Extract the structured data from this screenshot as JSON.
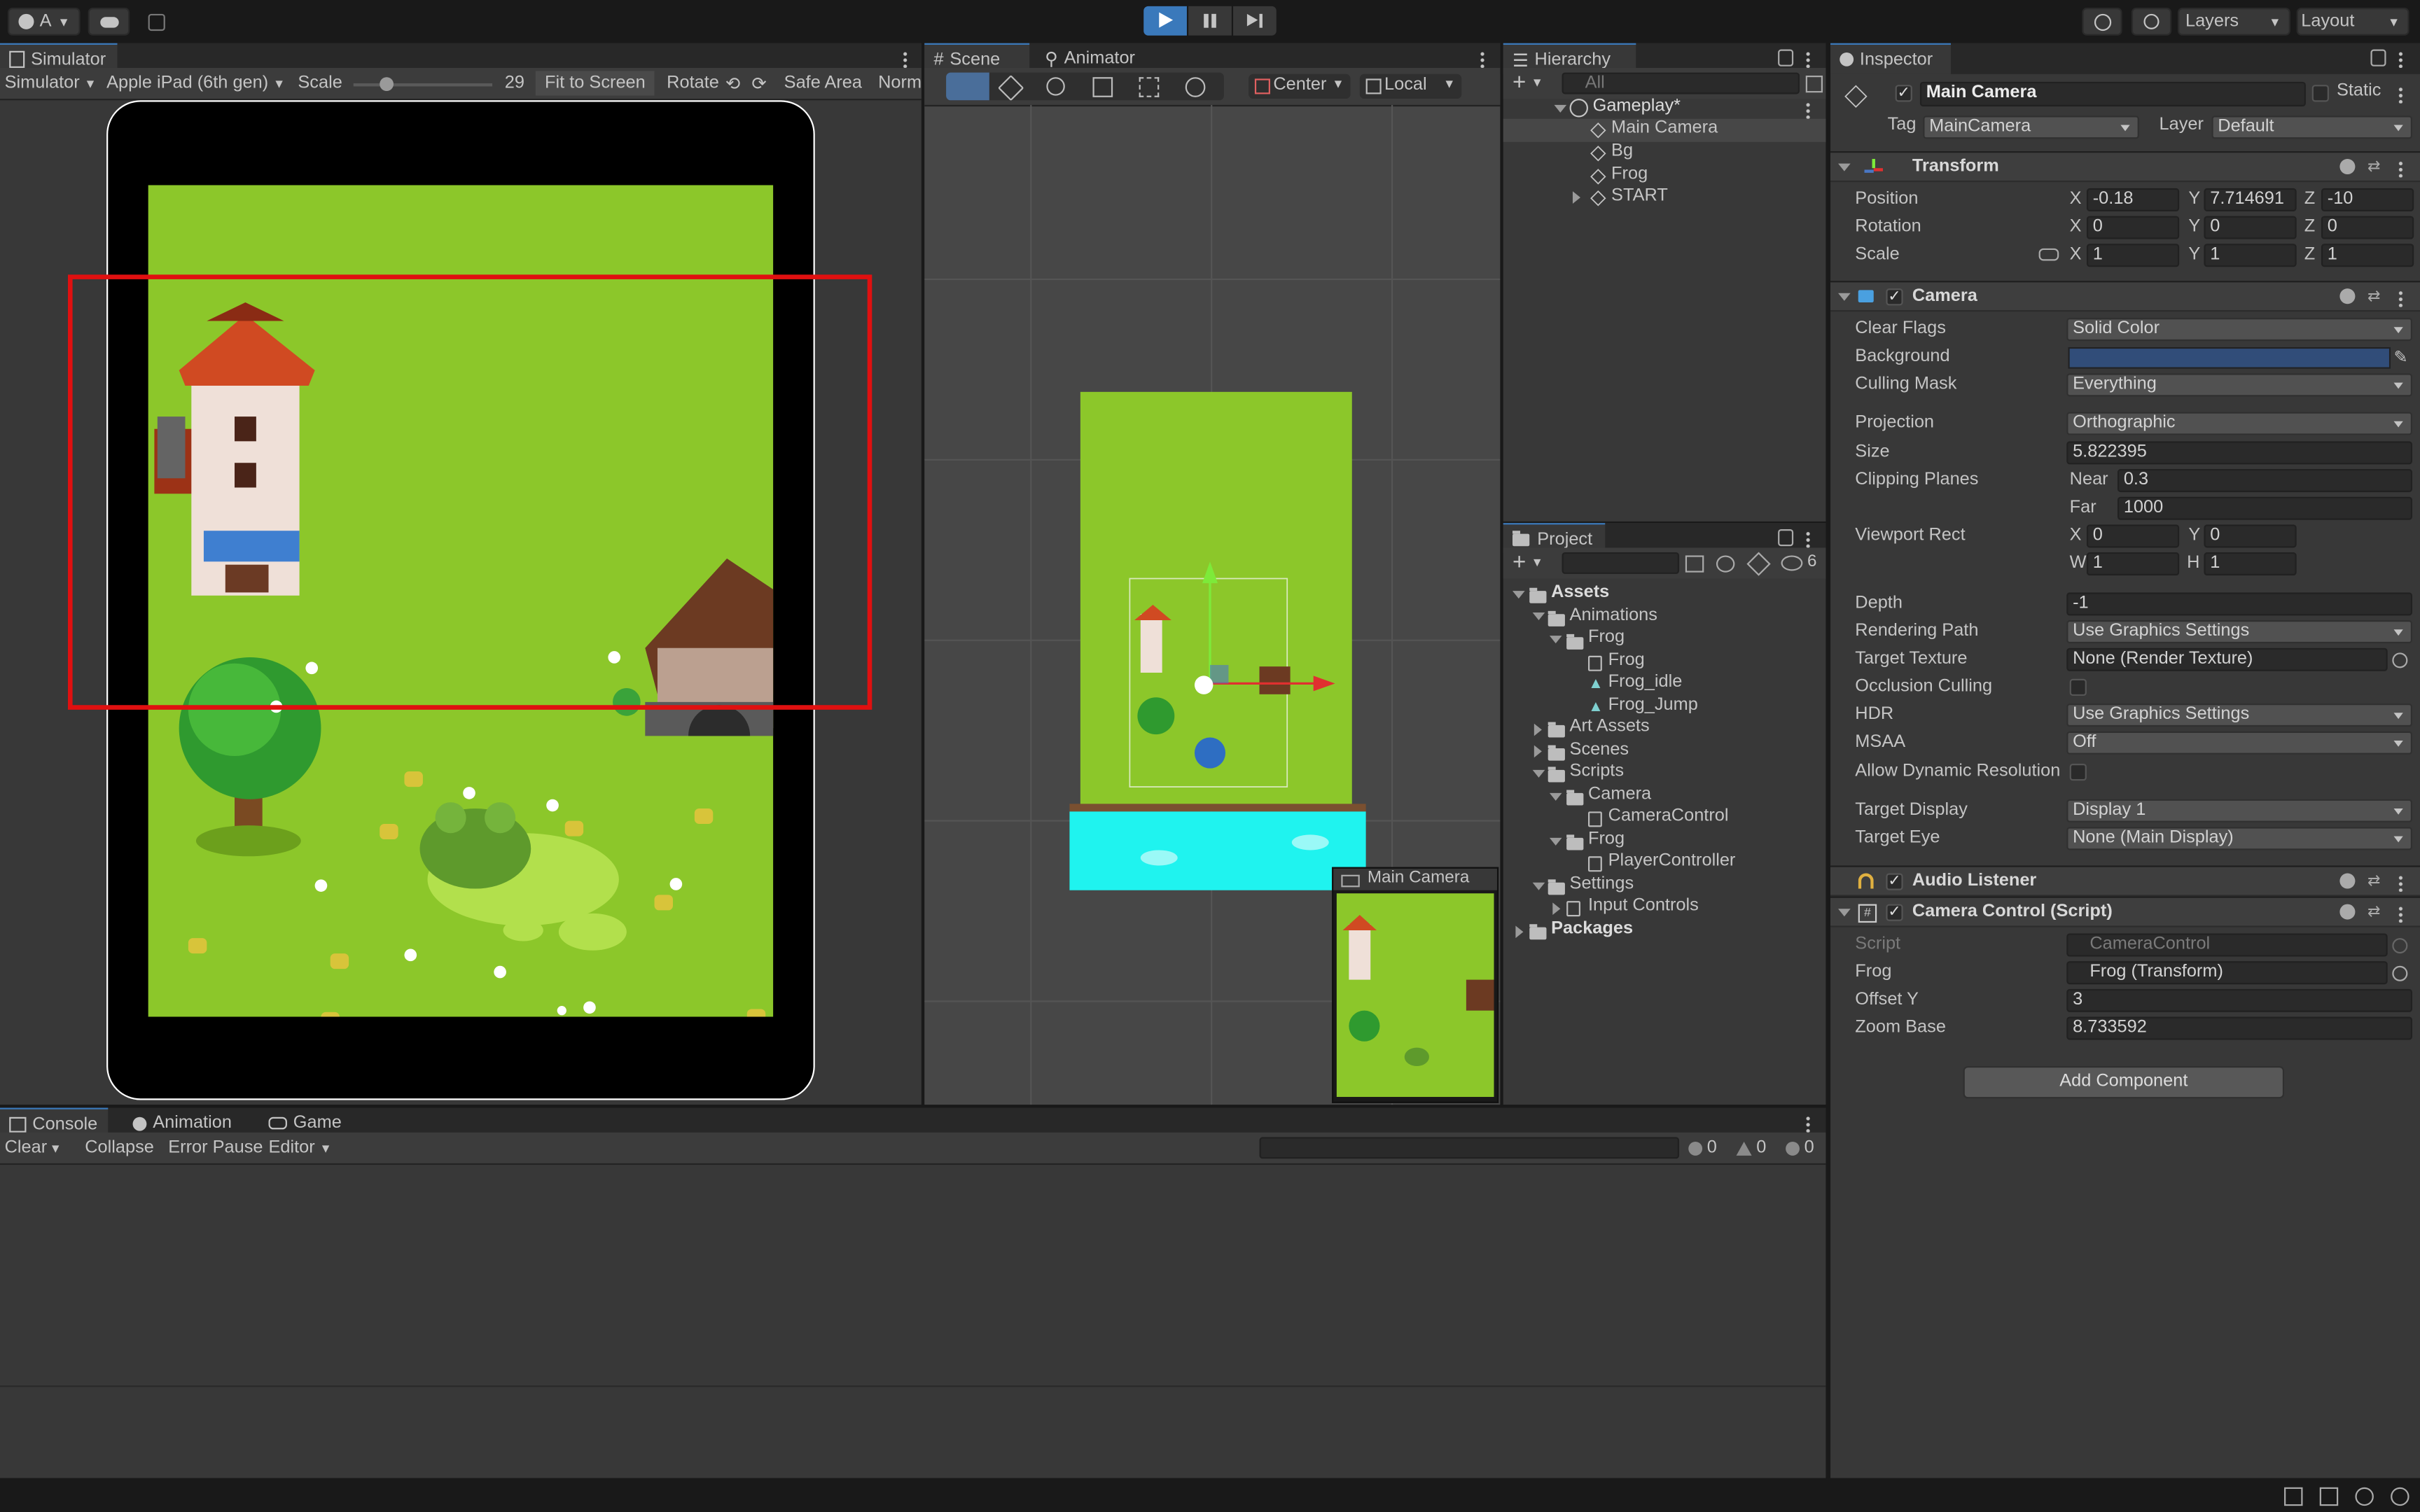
{
  "topbar": {
    "account_label": "A",
    "layers_label": "Layers",
    "layout_label": "Layout"
  },
  "simulator": {
    "tab_label": "Simulator",
    "mode_dropdown": "Simulator",
    "device_dropdown": "Apple iPad (6th gen)",
    "scale_label": "Scale",
    "scale_value": "29",
    "fit_label": "Fit to Screen",
    "rotate_label": "Rotate",
    "safe_area_label": "Safe Area",
    "norm_label": "Norm"
  },
  "scene": {
    "tab_scene": "Scene",
    "tab_animator": "Animator",
    "pivot_dropdown": "Center",
    "space_dropdown": "Local",
    "camera_preview_title": "Main Camera"
  },
  "hierarchy": {
    "tab_label": "Hierarchy",
    "search_placeholder": "All",
    "scene_name": "Gameplay*",
    "items": [
      {
        "label": "Main Camera",
        "selected": true
      },
      {
        "label": "Bg"
      },
      {
        "label": "Frog"
      },
      {
        "label": "START"
      }
    ]
  },
  "project": {
    "tab_label": "Project",
    "hidden_count": "6",
    "tree": {
      "assets": "Assets",
      "animations": "Animations",
      "anim_frog_folder": "Frog",
      "anim_frog": "Frog",
      "anim_frog_idle": "Frog_idle",
      "anim_frog_jump": "Frog_Jump",
      "art_assets": "Art Assets",
      "scenes": "Scenes",
      "scripts": "Scripts",
      "camera_folder": "Camera",
      "camera_control": "CameraControl",
      "frog_folder": "Frog",
      "player_controller": "PlayerController",
      "settings": "Settings",
      "input_controls": "Input Controls",
      "packages": "Packages"
    }
  },
  "inspector": {
    "tab_label": "Inspector",
    "object_name": "Main Camera",
    "static_label": "Static",
    "tag_label": "Tag",
    "tag_value": "MainCamera",
    "layer_label": "Layer",
    "layer_value": "Default",
    "transform": {
      "title": "Transform",
      "position_label": "Position",
      "pos_x": "-0.18",
      "pos_y": "7.714691",
      "pos_z": "-10",
      "rotation_label": "Rotation",
      "rot_x": "0",
      "rot_y": "0",
      "rot_z": "0",
      "scale_label": "Scale",
      "scl_x": "1",
      "scl_y": "1",
      "scl_z": "1"
    },
    "axis": {
      "x": "X",
      "y": "Y",
      "z": "Z",
      "w": "W",
      "h": "H"
    },
    "camera": {
      "title": "Camera",
      "clear_flags_label": "Clear Flags",
      "clear_flags": "Solid Color",
      "background_label": "Background",
      "background_color": "#314d79",
      "culling_mask_label": "Culling Mask",
      "culling_mask": "Everything",
      "projection_label": "Projection",
      "projection": "Orthographic",
      "size_label": "Size",
      "size": "5.822395",
      "clipping_label": "Clipping Planes",
      "near_label": "Near",
      "near": "0.3",
      "far_label": "Far",
      "far": "1000",
      "viewport_label": "Viewport Rect",
      "vp_x": "0",
      "vp_y": "0",
      "vp_w": "1",
      "vp_h": "1",
      "depth_label": "Depth",
      "depth": "-1",
      "rendering_path_label": "Rendering Path",
      "rendering_path": "Use Graphics Settings",
      "target_texture_label": "Target Texture",
      "target_texture": "None (Render Texture)",
      "occlusion_label": "Occlusion Culling",
      "hdr_label": "HDR",
      "hdr": "Use Graphics Settings",
      "msaa_label": "MSAA",
      "msaa": "Off",
      "dynres_label": "Allow Dynamic Resolution",
      "target_display_label": "Target Display",
      "target_display": "Display 1",
      "target_eye_label": "Target Eye",
      "target_eye": "None (Main Display)"
    },
    "audio_listener": {
      "title": "Audio Listener"
    },
    "camera_control": {
      "title": "Camera Control (Script)",
      "script_label": "Script",
      "script": "CameraControl",
      "frog_label": "Frog",
      "frog": "Frog (Transform)",
      "offset_label": "Offset Y",
      "offset": "3",
      "zoom_label": "Zoom Base",
      "zoom": "8.733592"
    },
    "add_component": "Add Component"
  },
  "console": {
    "tab_console": "Console",
    "tab_animation": "Animation",
    "tab_game": "Game",
    "clear_label": "Clear",
    "collapse_label": "Collapse",
    "error_pause_label": "Error Pause",
    "editor_label": "Editor",
    "log_count": "0",
    "warn_count": "0",
    "error_count": "0"
  },
  "colors": {
    "accent": "#3a79bb",
    "grass": "#8cc72a",
    "water": "#1ff3ef",
    "highlight_rect": "#e01010"
  }
}
